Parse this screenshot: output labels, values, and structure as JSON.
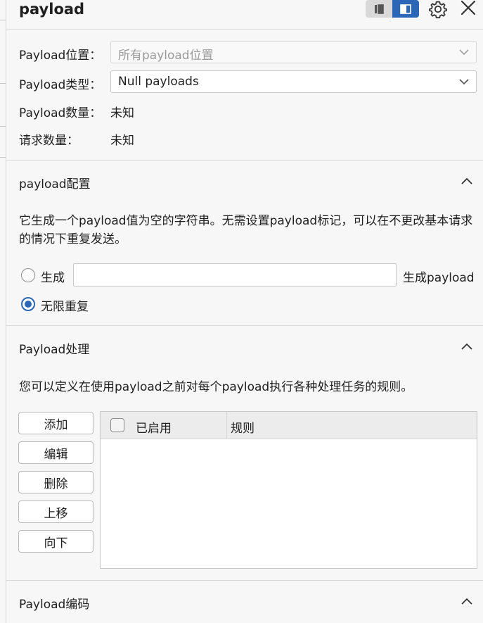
{
  "header": {
    "title": "payload",
    "icons": [
      "list-view-icon",
      "panel-view-icon",
      "gear-icon",
      "close-icon"
    ]
  },
  "positions": {
    "label": "Payload位置：",
    "value": "所有payload位置"
  },
  "type": {
    "label": "Payload类型：",
    "value": "Null payloads"
  },
  "count": {
    "label": "Payload数量：",
    "value": "未知"
  },
  "requests": {
    "label": "请求数量：",
    "value": "未知"
  },
  "config": {
    "title": "payload配置",
    "description": "它生成一个payload值为空的字符串。无需设置payload标记，可以在不更改基本请求的情况下重复发送。",
    "generate_label": "生成",
    "generate_value": "",
    "generate_suffix": "生成payload",
    "infinite_label": "无限重复",
    "selected": "infinite"
  },
  "processing": {
    "title": "Payload处理",
    "description": "您可以定义在使用payload之前对每个payload执行各种处理任务的规则。",
    "buttons": {
      "add": "添加",
      "edit": "编辑",
      "delete": "删除",
      "up": "上移",
      "down": "向下"
    },
    "columns": {
      "enabled": "已启用",
      "rule": "规则"
    },
    "rows": []
  },
  "encoding": {
    "title": "Payload编码"
  },
  "colors": {
    "accent": "#2b67b6",
    "background": "#f7f7f7"
  }
}
